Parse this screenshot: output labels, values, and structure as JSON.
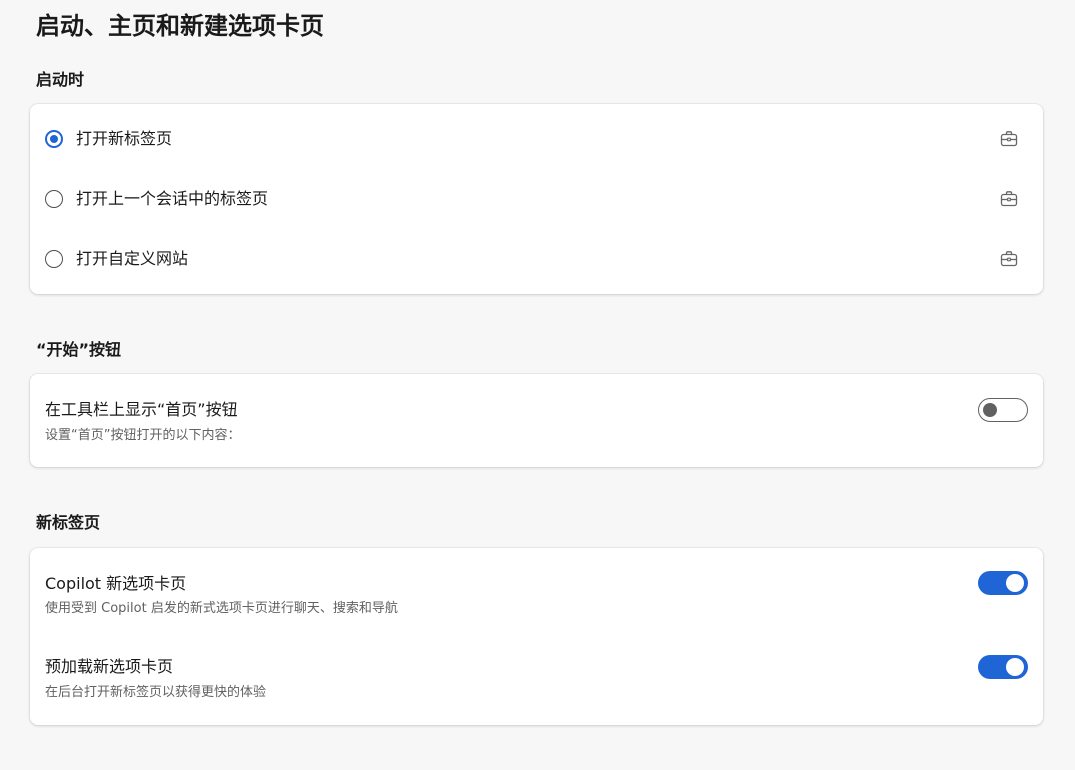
{
  "page": {
    "title": "启动、主页和新建选项卡页"
  },
  "startup": {
    "heading": "启动时",
    "selected_index": 0,
    "options": [
      {
        "label": "打开新标签页",
        "checked": true,
        "icon": "briefcase-icon"
      },
      {
        "label": "打开上一个会话中的标签页",
        "checked": false,
        "icon": "briefcase-icon"
      },
      {
        "label": "打开自定义网站",
        "checked": false,
        "icon": "briefcase-icon"
      }
    ]
  },
  "home_button": {
    "heading": "“开始”按钮",
    "title": "在工具栏上显示“首页”按钮",
    "description": "设置“首页”按钮打开的以下内容：",
    "enabled": false
  },
  "new_tab": {
    "heading": "新标签页",
    "items": [
      {
        "title": "Copilot 新选项卡页",
        "description": "使用受到 Copilot 启发的新式选项卡页进行聊天、搜索和导航",
        "enabled": true
      },
      {
        "title": "预加载新选项卡页",
        "description": "在后台打开新标签页以获得更快的体验",
        "enabled": true
      }
    ]
  },
  "colors": {
    "accent": "#1f65d6",
    "background": "#f7f7f7",
    "card": "#ffffff",
    "muted_text": "#616161"
  }
}
